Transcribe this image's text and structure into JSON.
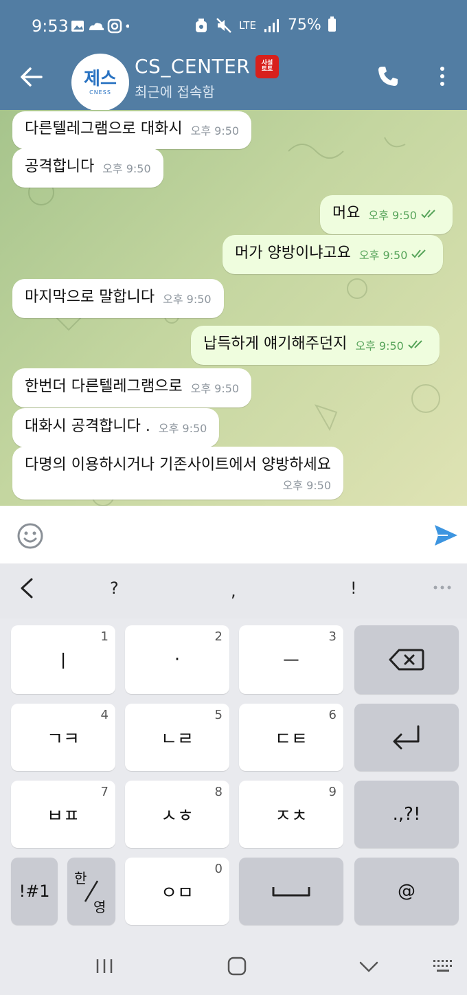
{
  "status_bar": {
    "time": "9:53",
    "network": "LTE",
    "battery": "75%"
  },
  "header": {
    "title": "CS_CENTER",
    "subtitle": "최근에 접속함",
    "avatar_text": "제스",
    "avatar_subtext": "CNESS",
    "badge_text": "사설토토"
  },
  "messages": [
    {
      "dir": "in",
      "text": "다른텔레그램으로 대화시",
      "time": "오후 9:50"
    },
    {
      "dir": "in",
      "text": "공격합니다",
      "time": "오후 9:50"
    },
    {
      "dir": "out",
      "text": "머요",
      "time": "오후 9:50"
    },
    {
      "dir": "out",
      "text": "머가 양방이냐고요",
      "time": "오후 9:50"
    },
    {
      "dir": "in",
      "text": "마지막으로 말합니다",
      "time": "오후 9:50"
    },
    {
      "dir": "out",
      "text": "납득하게 얘기해주던지",
      "time": "오후 9:50"
    },
    {
      "dir": "in",
      "text": "한번더 다른텔레그램으로",
      "time": "오후 9:50"
    },
    {
      "dir": "in",
      "text": "대화시 공격합니다 .",
      "time": "오후 9:50"
    },
    {
      "dir": "in",
      "text": "다명의 이용하시거나 기존사이트에서 양방하세요",
      "time": "오후 9:50"
    }
  ],
  "input": {
    "value": "",
    "placeholder": ""
  },
  "keyboard": {
    "toolbar": [
      "?",
      ",",
      "!"
    ],
    "rows": [
      [
        {
          "label": "ㅣ",
          "num": "1"
        },
        {
          "label": "·",
          "num": "2"
        },
        {
          "label": "ㅡ",
          "num": "3"
        },
        {
          "label": "",
          "num": ""
        }
      ],
      [
        {
          "label": "ㄱㅋ",
          "num": "4"
        },
        {
          "label": "ㄴㄹ",
          "num": "5"
        },
        {
          "label": "ㄷㅌ",
          "num": "6"
        },
        {
          "label": "",
          "num": ""
        }
      ],
      [
        {
          "label": "ㅂㅍ",
          "num": "7"
        },
        {
          "label": "ㅅㅎ",
          "num": "8"
        },
        {
          "label": "ㅈㅊ",
          "num": "9"
        },
        {
          "label": ".,?!",
          "num": ""
        }
      ],
      [
        {
          "label": "!#1",
          "num": ""
        },
        {
          "label": "한/영",
          "num": ""
        },
        {
          "label": "ㅇㅁ",
          "num": "0"
        },
        {
          "label": "",
          "num": ""
        },
        {
          "label": "@",
          "num": ""
        }
      ]
    ],
    "lang_top": "한",
    "lang_bottom": "영"
  }
}
